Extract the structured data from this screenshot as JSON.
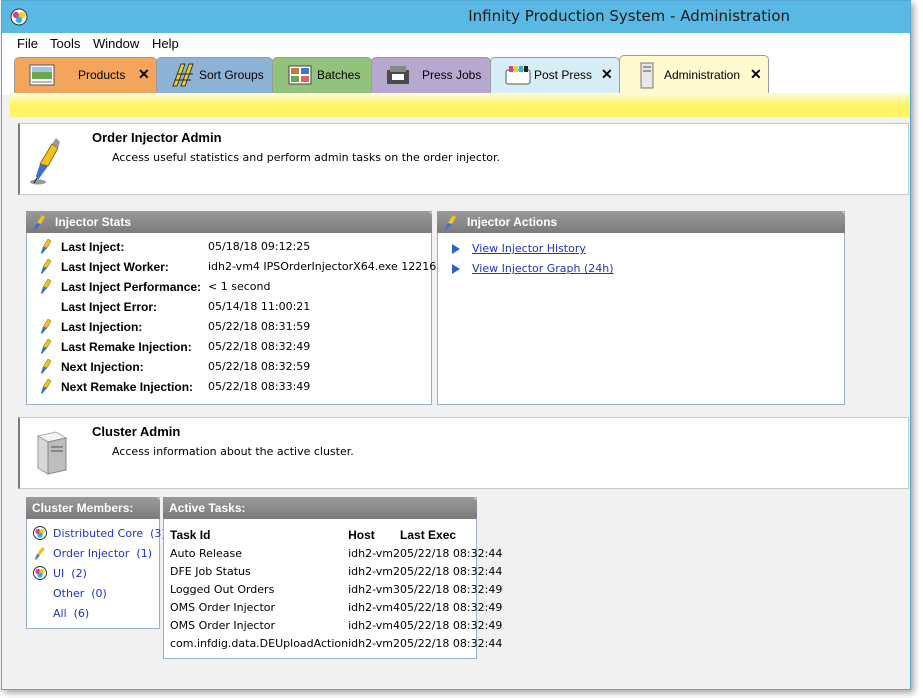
{
  "window": {
    "title": "Infinity Production System - Administration"
  },
  "menu": {
    "items": [
      "File",
      "Tools",
      "Window",
      "Help"
    ]
  },
  "tabs": [
    {
      "label": "Products",
      "color": "#f4a55c",
      "closable": true
    },
    {
      "label": "Sort Groups",
      "color": "#8fb3d6",
      "closable": false
    },
    {
      "label": "Batches",
      "color": "#93c27c",
      "closable": false
    },
    {
      "label": "Press Jobs",
      "color": "#b6a8cf",
      "closable": false
    },
    {
      "label": "Post Press",
      "color": "#d8eef6",
      "closable": true
    },
    {
      "label": "Administration",
      "color": "#fffad0",
      "closable": true,
      "active": true
    }
  ],
  "close_glyph": "✕",
  "order_injector": {
    "title": "Order Injector Admin",
    "description": "Access useful statistics and perform admin tasks on the order injector."
  },
  "injector_stats": {
    "header": "Injector Stats",
    "rows": [
      {
        "label": "Last Inject:",
        "value": "05/18/18 09:12:25",
        "icon": true
      },
      {
        "label": "Last Inject Worker:",
        "value": "idh2-vm4 IPSOrderInjectorX64.exe 12216...",
        "icon": true
      },
      {
        "label": "Last Inject Performance:",
        "value": "< 1 second",
        "icon": true
      },
      {
        "label": "Last Inject Error:",
        "value": "05/14/18 11:00:21",
        "icon": false
      },
      {
        "label": "Last Injection:",
        "value": "05/22/18 08:31:59",
        "icon": true
      },
      {
        "label": "Last Remake Injection:",
        "value": "05/22/18 08:32:49",
        "icon": true
      },
      {
        "label": "Next Injection:",
        "value": "05/22/18 08:32:59",
        "icon": true
      },
      {
        "label": "Next Remake Injection:",
        "value": "05/22/18 08:33:49",
        "icon": true
      }
    ]
  },
  "injector_actions": {
    "header": "Injector Actions",
    "links": [
      "View Injector History",
      "View Injector Graph (24h)"
    ]
  },
  "cluster_admin": {
    "title": "Cluster Admin",
    "description": "Access information about the active cluster."
  },
  "cluster_members": {
    "header": "Cluster Members:",
    "items": [
      {
        "label": "Distributed Core",
        "count": "(3)",
        "icon": "distributed-core-icon"
      },
      {
        "label": "Order Injector",
        "count": "(1)",
        "icon": "order-injector-icon"
      },
      {
        "label": "UI",
        "count": "(2)",
        "icon": "ui-icon"
      },
      {
        "label": "Other",
        "count": "(0)",
        "icon": ""
      },
      {
        "label": "All",
        "count": "(6)",
        "icon": ""
      }
    ]
  },
  "active_tasks": {
    "header": "Active Tasks:",
    "columns": [
      "Task Id",
      "Host",
      "Last Exec"
    ],
    "rows": [
      [
        "Auto Release",
        "idh2-vm2",
        "05/22/18 08:32:44"
      ],
      [
        "DFE Job Status",
        "idh2-vm2",
        "05/22/18 08:32:44"
      ],
      [
        "Logged Out Orders",
        "idh2-vm3",
        "05/22/18 08:32:49"
      ],
      [
        "OMS Order Injector",
        "idh2-vm4",
        "05/22/18 08:32:49"
      ],
      [
        "OMS Order Injector",
        "idh2-vm4",
        "05/22/18 08:32:49"
      ],
      [
        "com.infdig.data.DEUploadAction",
        "idh2-vm2",
        "05/22/18 08:32:44"
      ]
    ]
  }
}
